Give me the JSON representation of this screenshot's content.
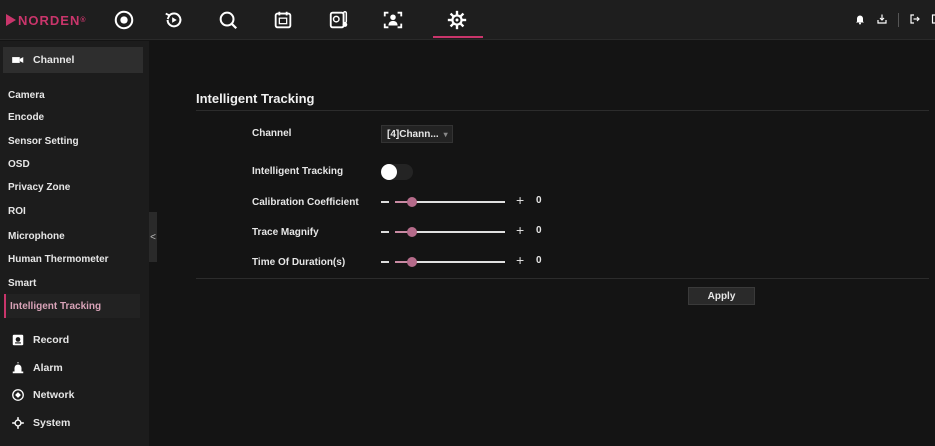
{
  "brand": {
    "name": "NORDEN",
    "reg": "®"
  },
  "colors": {
    "accent": "#c9356b",
    "background": "#141414",
    "sidebar": "#1c1c1c",
    "slider": "#b56b8a"
  },
  "top_nav": [
    "live-view-icon",
    "playback-icon",
    "search-icon",
    "calendar-icon",
    "thermometer-icon",
    "face-scan-icon",
    "gear-icon"
  ],
  "top_nav_active": "gear-icon",
  "sidebar": {
    "channel_label": "Channel",
    "channel_items": [
      "Camera",
      "Encode",
      "Sensor Setting",
      "OSD",
      "Privacy Zone",
      "ROI",
      "Microphone",
      "Human Thermometer",
      "Smart",
      "Intelligent Tracking"
    ],
    "selected_item": "Intelligent Tracking",
    "record_label": "Record",
    "alarm_label": "Alarm",
    "network_label": "Network",
    "system_label": "System",
    "collapse": "<"
  },
  "main": {
    "title": "Intelligent Tracking",
    "channel_label": "Channel",
    "channel_value": "[4]Chann...",
    "tracking_label": "Intelligent Tracking",
    "tracking_on": false,
    "calibration_label": "Calibration Coefficient",
    "calibration_value": "0",
    "calibration_level": 0.15,
    "trace_label": "Trace Magnify",
    "trace_value": "0",
    "trace_level": 0.15,
    "duration_label": "Time Of Duration(s)",
    "duration_value": "0",
    "duration_level": 0.15,
    "apply_label": "Apply"
  }
}
